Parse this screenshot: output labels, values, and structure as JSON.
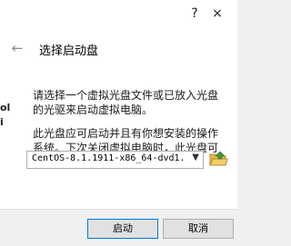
{
  "window": {
    "help_icon": "?",
    "close_icon": "×"
  },
  "header": {
    "back_icon": "←",
    "title": "选择启动盘"
  },
  "content": {
    "paragraph1": "请选择一个虚拟光盘文件或已放入光盘的光驱来启动虚拟电脑。",
    "paragraph2": "此光盘应可启动并且有你想安装的操作系统。下次关闭虚拟电脑时，此光盘可自动弹出；你也可以手动弹出。"
  },
  "disk_select": {
    "value": "CentOS-8.1.1911-x86_64-dvd1.",
    "chevron": "▼"
  },
  "folder_button": {
    "icon": "folder-open-icon",
    "color": "#e8b64a",
    "accent": "#3a9a3a"
  },
  "buttons": {
    "start_label": "启动",
    "cancel_label": "取消"
  },
  "edge_marks": [
    "ol",
    "i"
  ]
}
